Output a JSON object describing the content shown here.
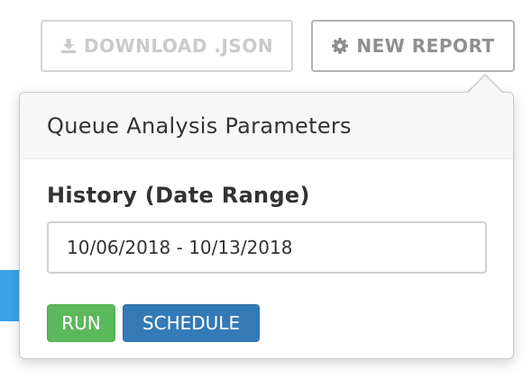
{
  "toolbar": {
    "download_label": "DOWNLOAD .JSON",
    "new_report_label": "NEW REPORT"
  },
  "popover": {
    "title": "Queue Analysis Parameters",
    "history_label": "History (Date Range)",
    "date_range_value": "10/06/2018 - 10/13/2018",
    "run_label": "RUN",
    "schedule_label": "SCHEDULE"
  },
  "icons": {
    "download": "download-icon",
    "new_report": "gear-icon"
  },
  "colors": {
    "run_button": "#5cb85c",
    "schedule_button": "#337ab7",
    "disabled_text": "#cacaca",
    "edge_accent": "#3ca3e8"
  }
}
